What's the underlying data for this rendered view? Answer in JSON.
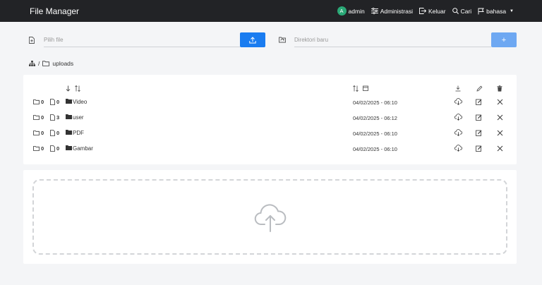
{
  "header": {
    "brand": "File Manager",
    "user": {
      "avatar_initial": "A",
      "name": "admin"
    },
    "admin_label": "Administrasi",
    "logout_label": "Keluar",
    "search_label": "Cari",
    "language_label": "bahasa"
  },
  "upload": {
    "file_placeholder": "Pilih file",
    "dir_placeholder": "Direktori baru",
    "add_label": "+"
  },
  "breadcrumb": {
    "separator": "/",
    "current": "uploads"
  },
  "files": [
    {
      "folders": "0",
      "files": "0",
      "name": "Video",
      "date": "04/02/2025 - 06:10"
    },
    {
      "folders": "0",
      "files": "3",
      "name": "user",
      "date": "04/02/2025 - 06:12"
    },
    {
      "folders": "0",
      "files": "0",
      "name": "PDF",
      "date": "04/02/2025 - 06:10"
    },
    {
      "folders": "0",
      "files": "0",
      "name": "Gambar",
      "date": "04/02/2025 - 06:10"
    }
  ],
  "colors": {
    "nav_bg": "#222326",
    "primary": "#1a7cf0",
    "avatar": "#2aa876"
  }
}
